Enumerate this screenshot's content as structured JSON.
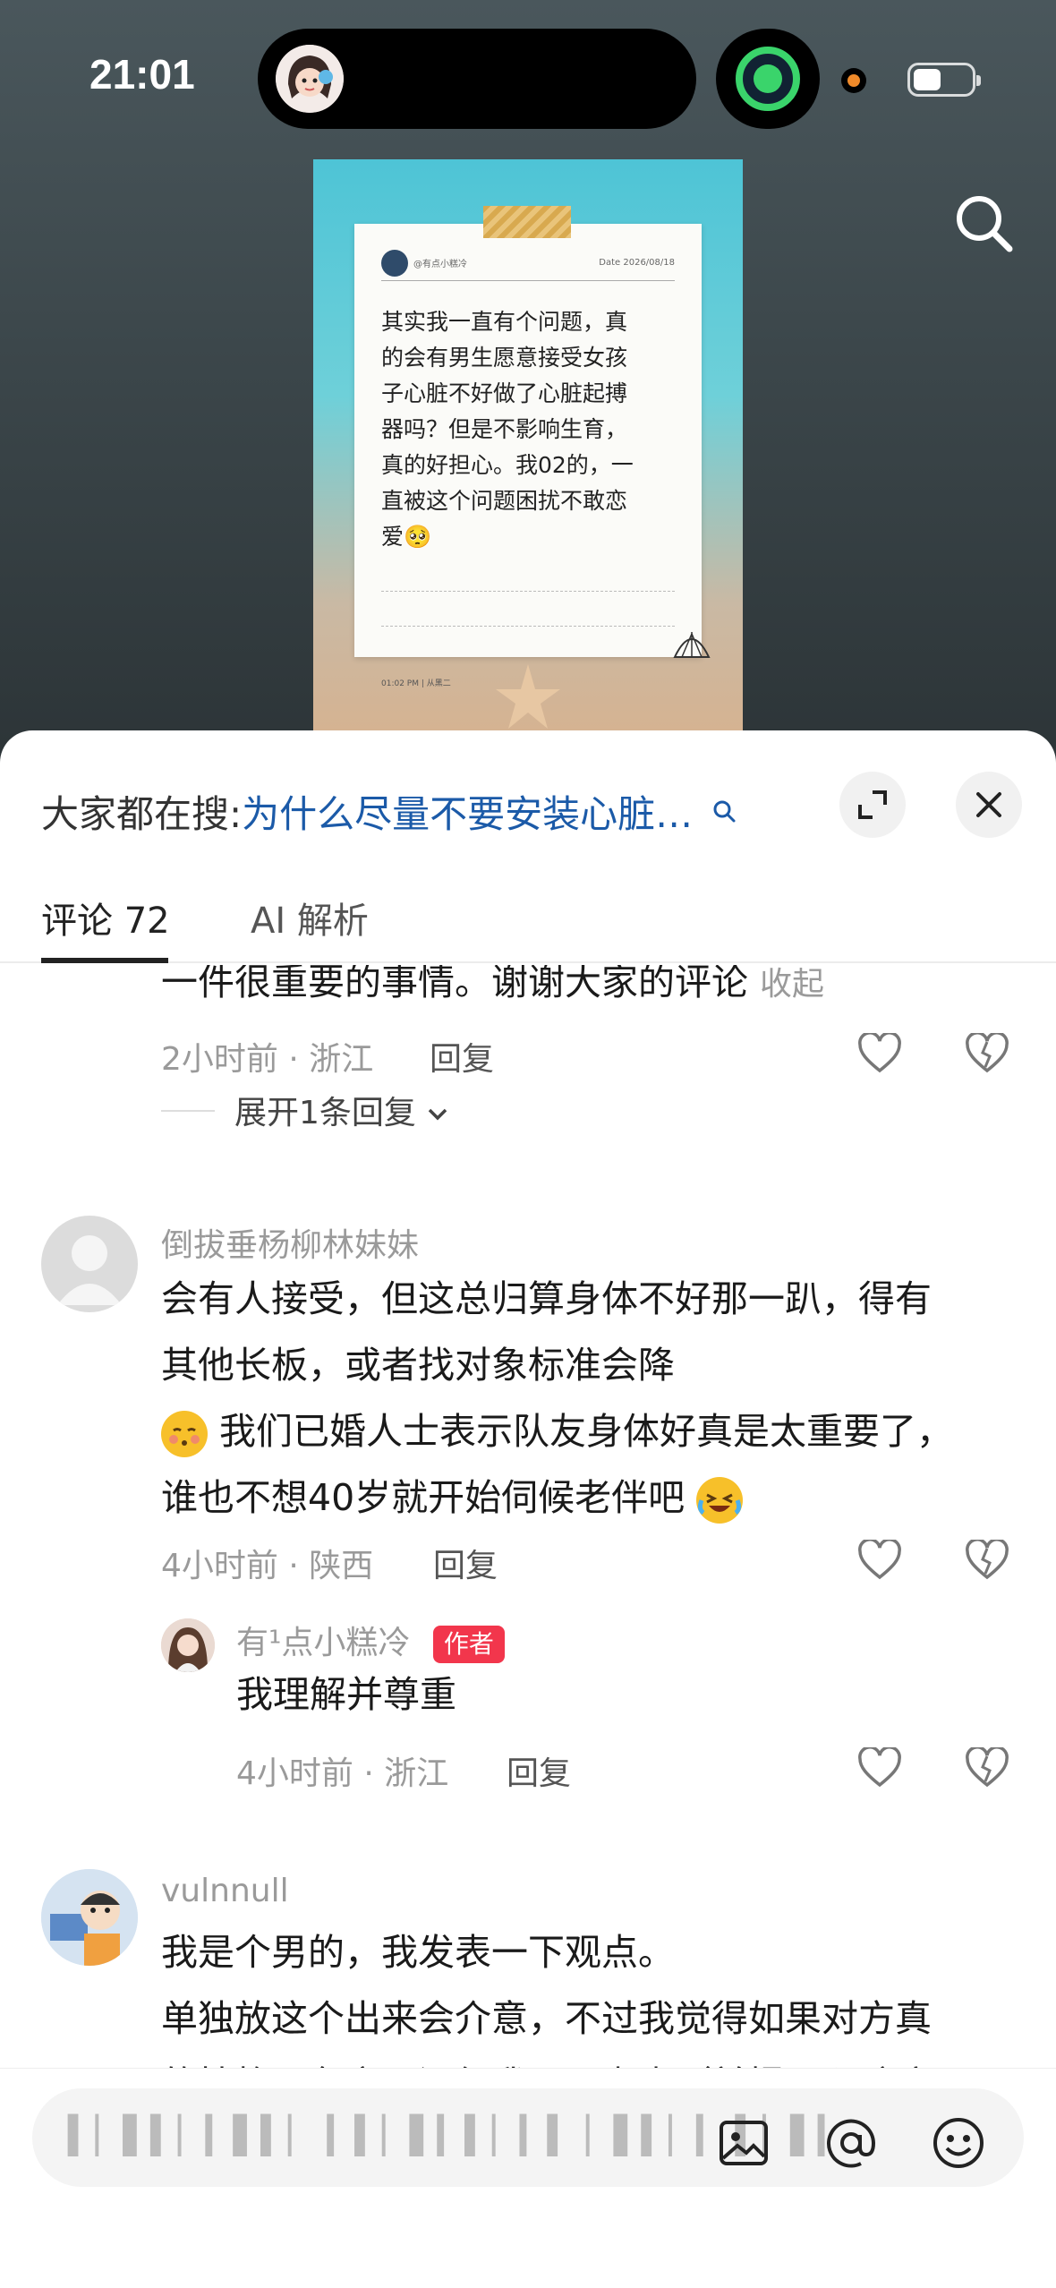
{
  "status": {
    "time": "21:01"
  },
  "note": {
    "handle": "@有点小糕冷",
    "date": "Date 2026/08/18",
    "lines": [
      "其实我一直有个问题，真",
      "的会有男生愿意接受女孩",
      "子心脏不好做了心脏起搏",
      "器吗？但是不影响生育，",
      "真的好担心。我02的，一",
      "直被这个问题困扰不敢恋",
      "爱🥺"
    ],
    "footer": "01:02 PM  |  从黑二"
  },
  "sheet": {
    "search_prefix": "大家都在搜:",
    "search_query": "为什么尽量不要安装心脏…"
  },
  "tabs": {
    "comments": "评论 72",
    "ai": "AI 解析"
  },
  "comment0": {
    "text": "一件很重要的事情。谢谢大家的评论",
    "collapse": "收起",
    "meta": "2小时前 · 浙江",
    "reply": "回复",
    "expand": "展开1条回复"
  },
  "comment1": {
    "name": "倒拔垂杨柳林妹妹",
    "line1": "会有人接受，但这总归算身体不好那一趴，得有",
    "line2": "其他长板，或者找对象标准会降",
    "line3": "我们已婚人士表示队友身体好真是太重要了，",
    "line4": "谁也不想40岁就开始伺候老伴吧",
    "meta": "4小时前 · 陕西",
    "reply": "回复"
  },
  "reply1": {
    "name": "有¹点小糕冷",
    "tag": "作者",
    "text": "我理解并尊重",
    "meta": "4小时前 · 浙江",
    "reply": "回复"
  },
  "comment2": {
    "name": "vulnnull",
    "line1": "我是个男的，我发表一下观点。",
    "line2": "单独放这个出来会介意，不过我觉得如果对方真",
    "line3": "的性格、各方面还行我可以考虑（前提是心脏病"
  },
  "input": {
    "placeholder": "▍▏▌▍▏▎▌▍▏ ▎▍▏▌▎▍▏▎▍ ▏▌▍▏▎ ▍▏▌▎"
  },
  "icons": [
    "search-icon",
    "expand-icon",
    "close-icon",
    "like-icon",
    "dislike-icon",
    "image-icon",
    "at-icon",
    "emoji-icon"
  ]
}
